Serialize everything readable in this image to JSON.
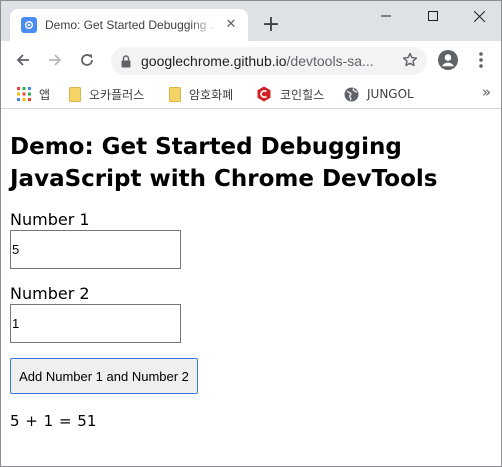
{
  "browser": {
    "tab_title": "Demo: Get Started Debugging JavaScript with Chrome DevTools",
    "url_host": "googlechrome.github.io",
    "url_path": "/devtools-sa...",
    "bookmarks": [
      {
        "icon": "apps-grid-icon",
        "label": "앱"
      },
      {
        "icon": "folder-icon",
        "label": "오카플러스"
      },
      {
        "icon": "folder-icon",
        "label": "암호화폐"
      },
      {
        "icon": "coinhills-icon",
        "label": "코인힐스"
      },
      {
        "icon": "globe-icon",
        "label": "JUNGOL"
      }
    ],
    "more_bookmarks": "»"
  },
  "page": {
    "title": "Demo: Get Started Debugging JavaScript with Chrome DevTools",
    "number1_label": "Number 1",
    "number1_value": "5",
    "number2_label": "Number 2",
    "number2_value": "1",
    "button_label": "Add Number 1 and Number 2",
    "result": "5 + 1 = 51"
  },
  "colors": {
    "accent": "#4b8bf4",
    "button_border": "#3b7be0",
    "coinhills_red": "#d32027",
    "folder_yellow": "#f6d365"
  }
}
